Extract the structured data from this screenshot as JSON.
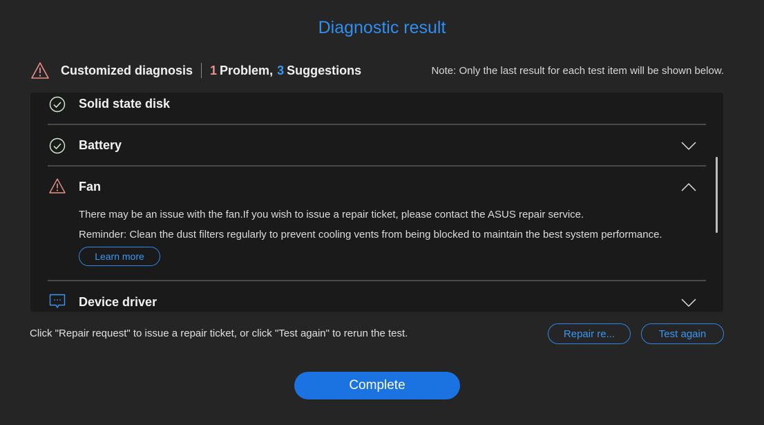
{
  "title": "Diagnostic result",
  "summary": {
    "label": "Customized diagnosis",
    "problem_count": "1",
    "problem_text": "Problem,",
    "suggestion_count": "3",
    "suggestion_text": "Suggestions",
    "icon": "warning-icon"
  },
  "note": "Note: Only the last result for each test item will be shown below.",
  "items": [
    {
      "name": "Solid state disk",
      "status": "pass",
      "icon": "check-circle-icon"
    },
    {
      "name": "Battery",
      "status": "pass",
      "icon": "check-circle-icon",
      "expanded": false
    },
    {
      "name": "Fan",
      "status": "warning",
      "icon": "warning-icon",
      "expanded": true,
      "message": "There may be an issue with the fan.If you wish to issue a repair ticket, please contact the ASUS repair service.",
      "reminder": "Reminder: Clean the dust filters regularly to prevent cooling vents from being blocked to maintain the best system performance.",
      "learn_more": "Learn more"
    },
    {
      "name": "Device driver",
      "status": "suggestion",
      "icon": "message-icon",
      "expanded": false
    }
  ],
  "footer": {
    "hint": "Click \"Repair request\" to issue a repair ticket, or click \"Test again\" to rerun the test.",
    "repair_label": "Repair re...",
    "test_again_label": "Test again",
    "complete_label": "Complete"
  },
  "colors": {
    "background": "#252525",
    "panel": "#1a1a1a",
    "accent": "#2f8ff0",
    "problem": "#e9918a",
    "pass": "#cfe8cf"
  }
}
